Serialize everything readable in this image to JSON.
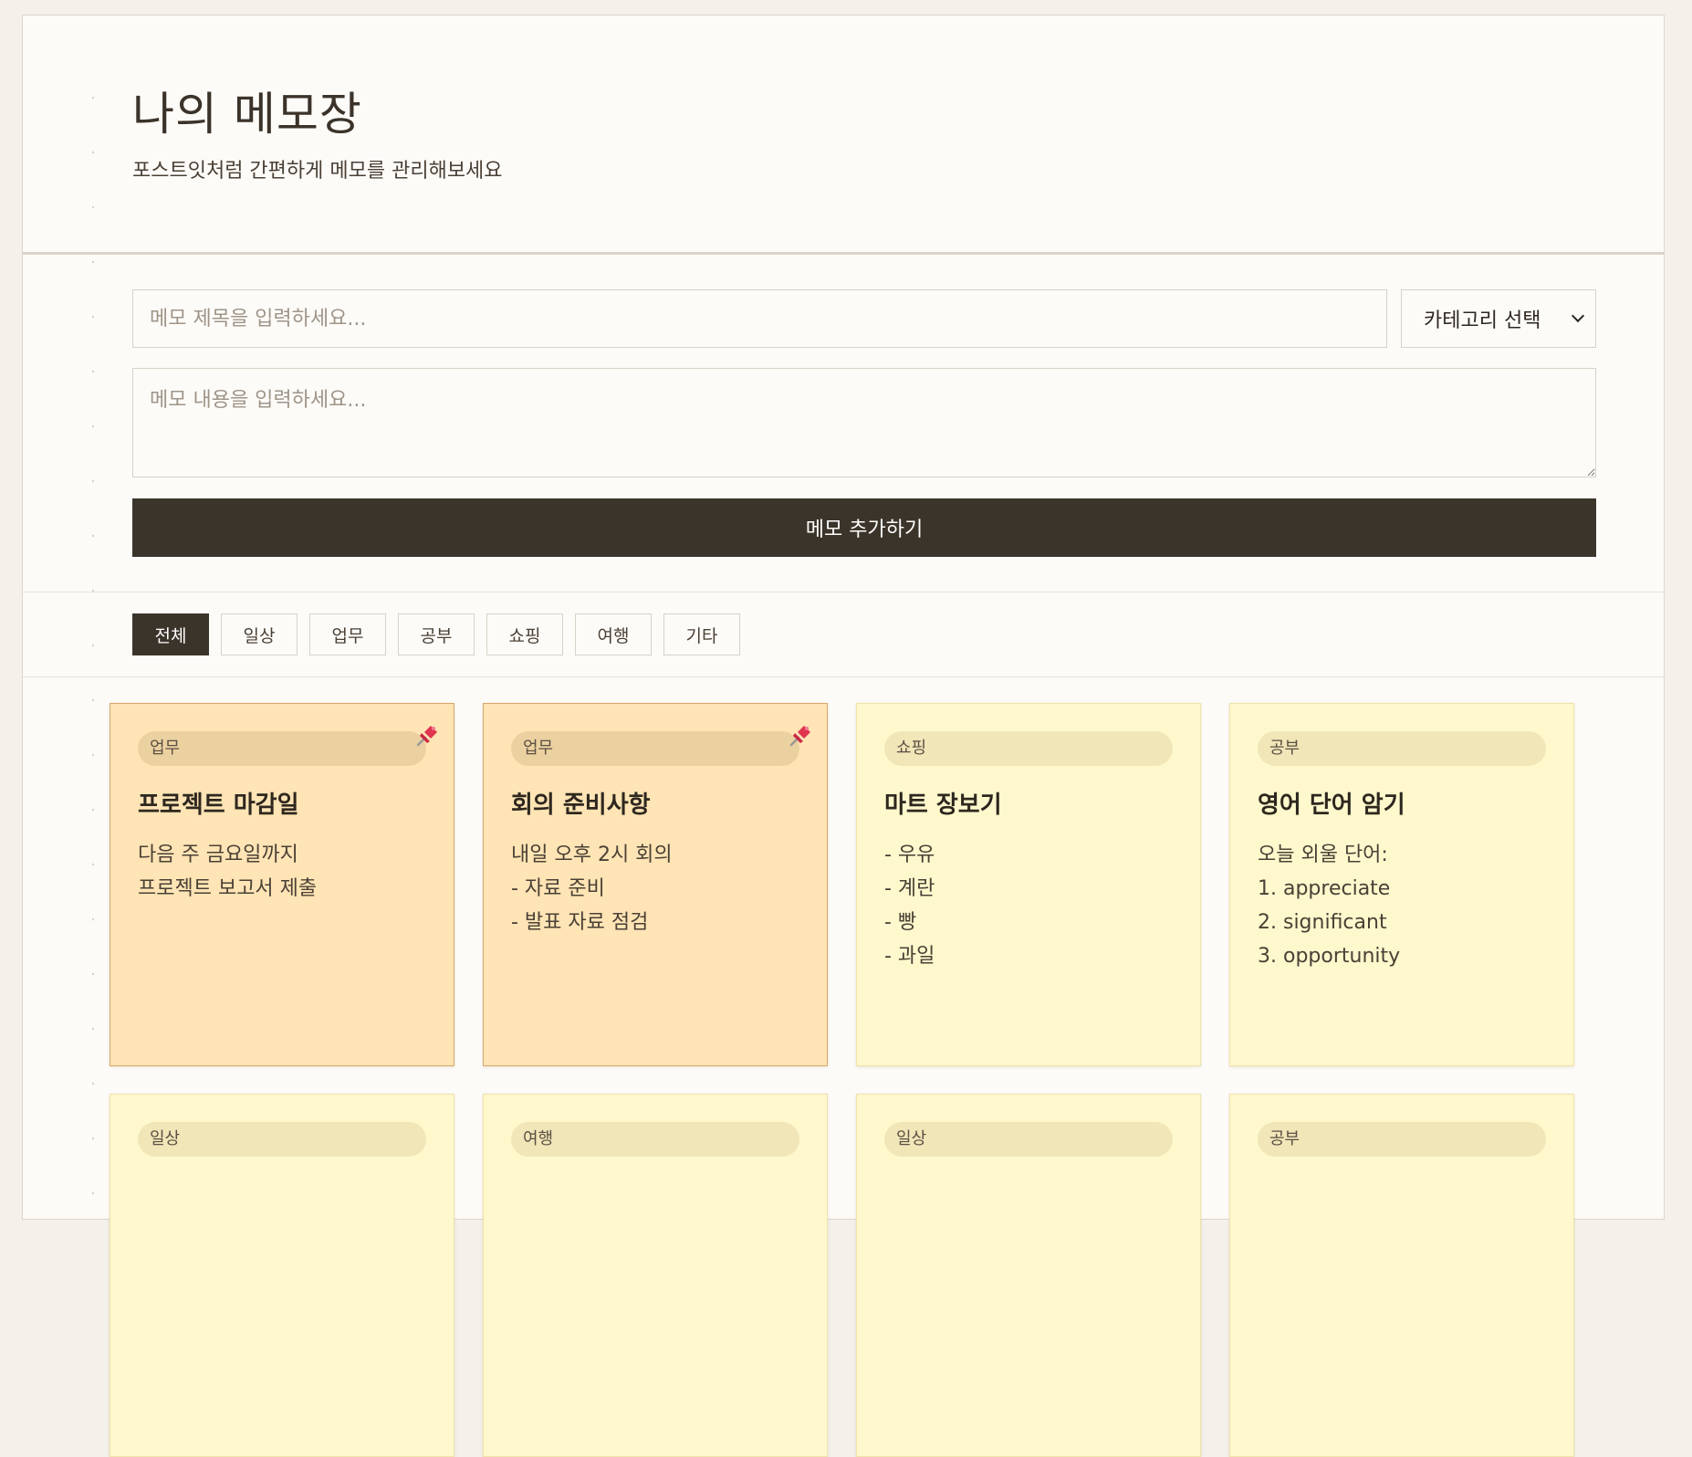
{
  "header": {
    "title": "나의 메모장",
    "subtitle": "포스트잇처럼 간편하게 메모를 관리해보세요"
  },
  "form": {
    "title_placeholder": "메모 제목을 입력하세요...",
    "category_selected": "카테고리 선택",
    "content_placeholder": "메모 내용을 입력하세요...",
    "add_button_label": "메모 추가하기"
  },
  "filters": [
    {
      "label": "전체",
      "active": true
    },
    {
      "label": "일상",
      "active": false
    },
    {
      "label": "업무",
      "active": false
    },
    {
      "label": "공부",
      "active": false
    },
    {
      "label": "쇼핑",
      "active": false
    },
    {
      "label": "여행",
      "active": false
    },
    {
      "label": "기타",
      "active": false
    }
  ],
  "memos": [
    {
      "category": "업무",
      "title": "프로젝트 마감일",
      "body": "다음 주 금요일까지\n프로젝트 보고서 제출",
      "pinned": true
    },
    {
      "category": "업무",
      "title": "회의 준비사항",
      "body": "내일 오후 2시 회의\n- 자료 준비\n- 발표 자료 점검",
      "pinned": true
    },
    {
      "category": "쇼핑",
      "title": "마트 장보기",
      "body": "- 우유\n- 계란\n- 빵\n- 과일",
      "pinned": false
    },
    {
      "category": "공부",
      "title": "영어 단어 암기",
      "body": "오늘 외울 단어:\n1. appreciate\n2. significant\n3. opportunity",
      "pinned": false
    },
    {
      "category": "일상",
      "title": "",
      "body": "",
      "pinned": false
    },
    {
      "category": "여행",
      "title": "",
      "body": "",
      "pinned": false
    },
    {
      "category": "일상",
      "title": "",
      "body": "",
      "pinned": false
    },
    {
      "category": "공부",
      "title": "",
      "body": "",
      "pinned": false
    }
  ],
  "colors": {
    "accent_dark": "#3b342a",
    "note_yellow": "#fff8cd",
    "note_pinned": "#ffe4b5",
    "pin": "#e0344f"
  },
  "icons": {
    "pin": "pushpin-icon",
    "select_arrow": "chevron-down-icon"
  }
}
